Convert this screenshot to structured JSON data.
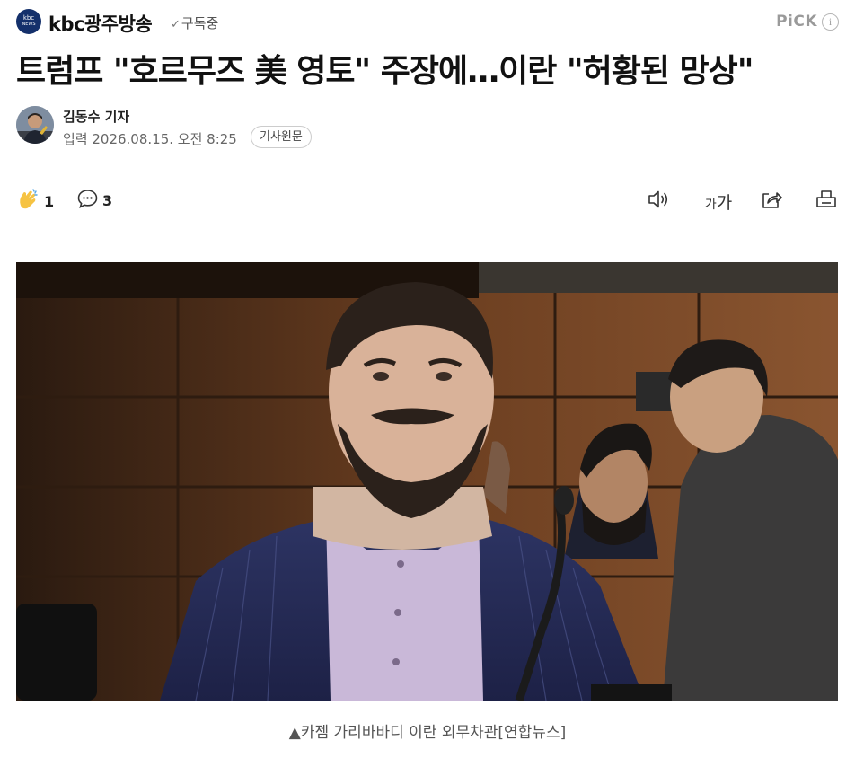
{
  "header": {
    "press_logo_top": "kbc",
    "press_logo_bottom": "NEWS",
    "press_name": "kbc광주방송",
    "subscribe_label": "구독중",
    "pick_label": "PiCK",
    "info_label": "i"
  },
  "article": {
    "headline": "트럼프 \"호르무즈 美 영토\" 주장에…이란 \"허황된 망상\"",
    "reporter": "김동수 기자",
    "date_line": "입력 2026.08.15. 오전 8:25",
    "original_button": "기사원문"
  },
  "actions": {
    "reaction_count": "1",
    "comment_count": "3",
    "font_size_small": "가",
    "font_size_large": "가"
  },
  "photo": {
    "caption": "▲카젬 가리바바디 이란 외무차관[연합뉴스]"
  },
  "colors": {
    "press_logo_bg": "#14306b",
    "reaction_yellow": "#f6c343"
  },
  "icons": {
    "check": "check-icon",
    "info": "info-icon",
    "reaction": "clap-hand-icon",
    "comment": "speech-bubble-icon",
    "audio": "speaker-icon",
    "font": "font-size-icon",
    "share": "share-icon",
    "print": "print-icon"
  }
}
